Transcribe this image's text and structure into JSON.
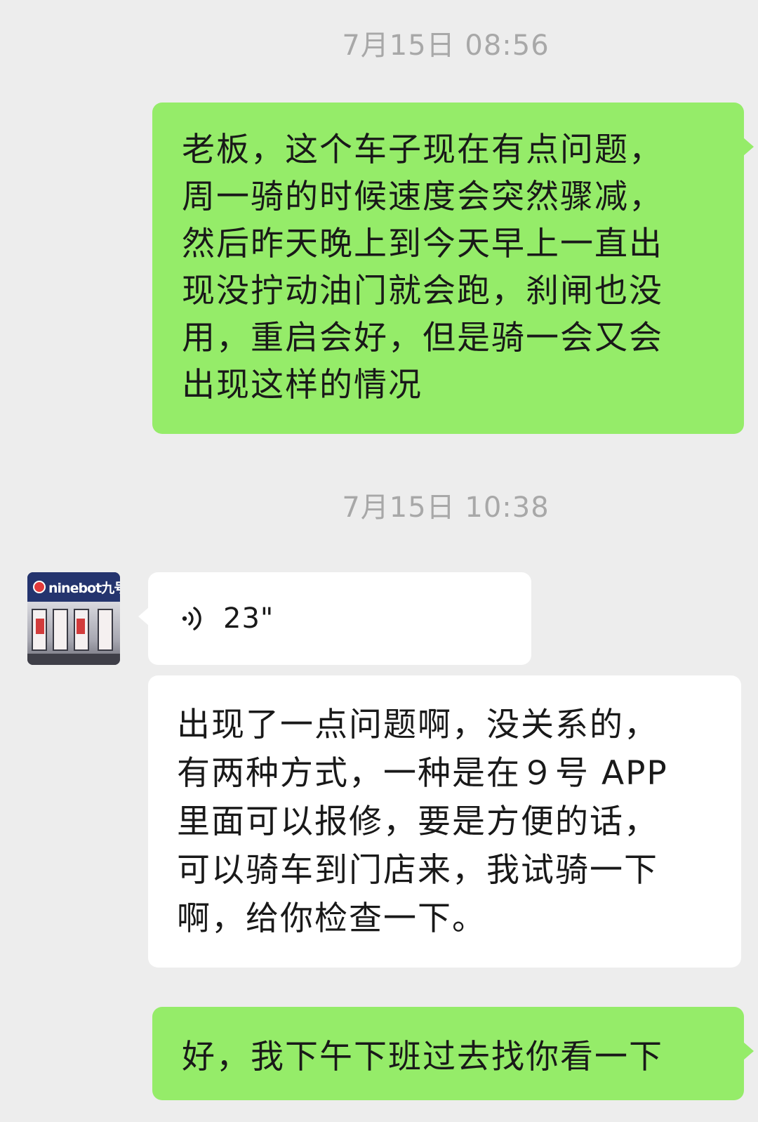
{
  "timestamps": [
    "7月15日 08:56",
    "7月15日 10:38"
  ],
  "messages": {
    "m1": {
      "lines": [
        "老板，这个车子现在有点问题，",
        "周一骑的时候速度会突然骤减，",
        "然后昨天晚上到今天早上一直出",
        "现没拧动油门就会跑，刹闸也没",
        "用，重启会好，但是骑一会又会",
        "出现这样的情况"
      ]
    },
    "voice": {
      "duration": "23\""
    },
    "m3": {
      "lines": [
        "出现了一点问题啊，没关系的，",
        "有两种方式，一种是在９号 APP",
        "里面可以报修，要是方便的话，",
        "可以骑车到门店来，我试骑一下",
        "啊，给你检查一下。"
      ]
    },
    "m4": {
      "text": "好，我下午下班过去找你看一下"
    }
  },
  "contact": {
    "avatar_sign_text": "ninebot九号"
  },
  "colors": {
    "background": "#ededed",
    "outgoing_bubble": "#95ec69",
    "incoming_bubble": "#ffffff",
    "timestamp": "#a8a8a8"
  }
}
